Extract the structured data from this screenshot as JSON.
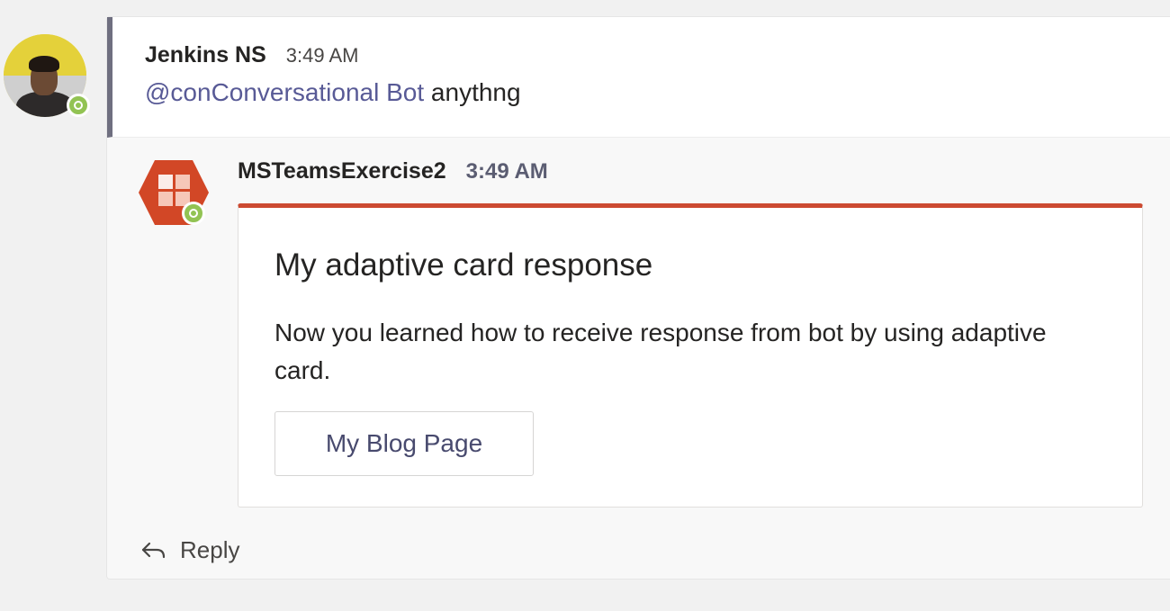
{
  "root_message": {
    "author": "Jenkins NS",
    "time": "3:49 AM",
    "mention": "@conConversational Bot",
    "text": " anythng"
  },
  "bot_message": {
    "author": "MSTeamsExercise2",
    "time": "3:49 AM",
    "card": {
      "accent_color": "#cc4a31",
      "title": "My adaptive card response",
      "body": "Now you learned how to receive response from bot by using adaptive card.",
      "button_label": "My Blog Page"
    }
  },
  "reply": {
    "label": "Reply",
    "icon": "reply-arrow-icon"
  },
  "status": {
    "presence": "available",
    "color": "#92c353"
  }
}
